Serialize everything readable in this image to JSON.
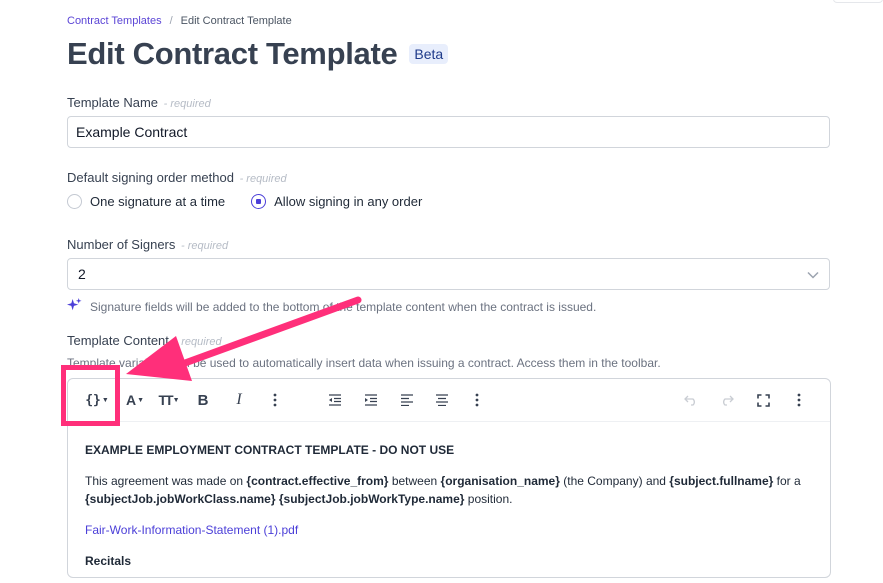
{
  "breadcrumb": {
    "parent": "Contract Templates",
    "separator": "/",
    "current": "Edit Contract Template"
  },
  "page": {
    "title": "Edit Contract Template",
    "badge": "Beta"
  },
  "template_name": {
    "label": "Template Name",
    "required": "- required",
    "value": "Example Contract"
  },
  "signing_order": {
    "label": "Default signing order method",
    "required": "- required",
    "options": [
      {
        "label": "One signature at a time",
        "selected": false
      },
      {
        "label": "Allow signing in any order",
        "selected": true
      }
    ]
  },
  "signers": {
    "label": "Number of Signers",
    "required": "- required",
    "value": "2"
  },
  "hint": "Signature fields will be added to the bottom of the template content when the contract is issued.",
  "template_content": {
    "label": "Template Content",
    "required": "- required",
    "help": "Template variables can be used to automatically insert data when issuing a contract. Access them in the toolbar."
  },
  "toolbar": {
    "variables": "{}",
    "font_color": "A",
    "font_size": "TT",
    "bold": "B",
    "italic": "I"
  },
  "document": {
    "heading": "EXAMPLE EMPLOYMENT CONTRACT TEMPLATE - DO NOT USE",
    "p1": {
      "t1": "This agreement was made on ",
      "v1": "{contract.effective_from}",
      "t2": " between ",
      "v2": "{organisation_name}",
      "t3": " (the Company) and ",
      "v3": "{subject.fullname}",
      "t4": " for a ",
      "v4": "{subjectJob.jobWorkClass.name}",
      "t5": " ",
      "v5": "{subjectJob.jobWorkType.name}",
      "t6": " position."
    },
    "attachment": "Fair-Work-Information-Statement (1).pdf",
    "section": "Recitals"
  },
  "colors": {
    "accent": "#4b3fd8",
    "annotation": "#ff2f7a"
  }
}
